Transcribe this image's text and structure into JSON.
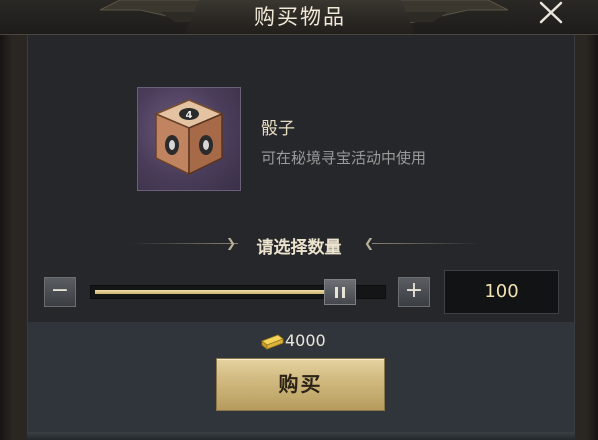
{
  "dialog": {
    "title": "购买物品"
  },
  "item": {
    "name": "骰子",
    "description": "可在秘境寻宝活动中使用",
    "icon": "dice-icon",
    "icon_face_label": "4"
  },
  "quantity": {
    "title": "请选择数量",
    "value": "100",
    "slider_fraction": 1.0
  },
  "price": {
    "currency_icon": "gold-ingot-icon",
    "amount": "4000"
  },
  "buttons": {
    "buy_label": "购买",
    "minus_label": "−",
    "plus_label": "+"
  },
  "colors": {
    "accent_gold": "#d4bd84",
    "quantity_text": "#f0e2b0",
    "item_frame_purple": "#4a3d5a"
  }
}
